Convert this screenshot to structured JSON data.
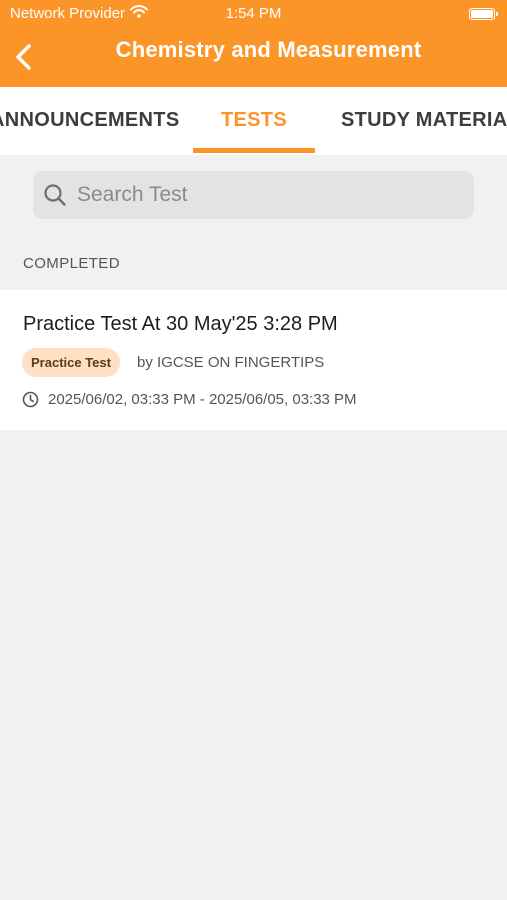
{
  "status_bar": {
    "carrier": "Network Provider",
    "time": "1:54 PM"
  },
  "header": {
    "title": "Chemistry and Measurement"
  },
  "tabs": [
    {
      "label": "ANNOUNCEMENTS",
      "selected": false
    },
    {
      "label": "TESTS",
      "selected": true
    },
    {
      "label": "STUDY MATERIALS",
      "selected": false
    }
  ],
  "search": {
    "placeholder": "Search Test",
    "value": ""
  },
  "section": {
    "label": "COMPLETED"
  },
  "tests": [
    {
      "title": "Practice Test At 30 May'25 3:28 PM",
      "badge": "Practice Test",
      "author": "by IGCSE ON FINGERTIPS",
      "schedule": "2025/06/02, 03:33 PM - 2025/06/05, 03:33 PM"
    }
  ],
  "colors": {
    "accent": "#fb9527",
    "badge_bg": "#fde1c2",
    "background": "#f1f1f1"
  },
  "icons": {
    "back": "chevron-left-icon",
    "wifi": "wifi-icon",
    "battery": "battery-icon",
    "search": "search-icon",
    "clock": "clock-icon"
  }
}
